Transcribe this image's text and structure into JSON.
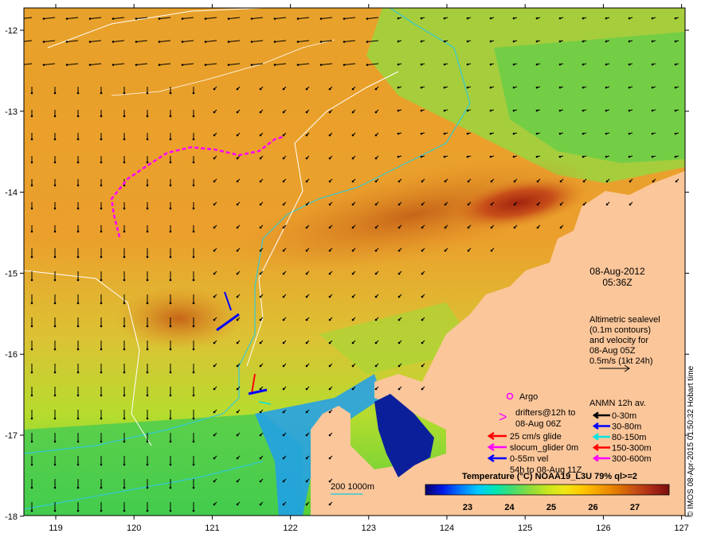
{
  "map": {
    "date": "08-Aug-2012",
    "time": "05:36Z",
    "lon_ticks": [
      "119",
      "120",
      "121",
      "122",
      "123",
      "124",
      "125",
      "126",
      "127"
    ],
    "lat_ticks": [
      "-12",
      "-13",
      "-14",
      "-15",
      "-16",
      "-17",
      "-18"
    ],
    "altimetry_note": [
      "Altimetric sealevel",
      "(0.1m contours)",
      "and velocity for",
      "08-Aug 05Z",
      "0.5m/s (1kt 24h)"
    ],
    "credit": "© IMOS 08-Apr-2015 01:50:32 Hobart time",
    "bathy_legend": "200  1000m"
  },
  "legend": {
    "argo": "Argo",
    "drifters": [
      "drifters@12h to",
      "08-Aug 06Z"
    ],
    "glide": "25 cm/s glide",
    "slocum": "slocum_glider 0m",
    "vel": [
      "0-55m vel",
      "54h to 08-Aug 11Z"
    ],
    "anmn_title": "ANMN 12h av.",
    "anmn": [
      {
        "label": "0-30m",
        "color": "#000000"
      },
      {
        "label": "30-80m",
        "color": "#0000ff"
      },
      {
        "label": "80-150m",
        "color": "#00e5e5"
      },
      {
        "label": "150-300m",
        "color": "#ff0000"
      },
      {
        "label": "300-600m",
        "color": "#ff00ff"
      }
    ]
  },
  "colorbar": {
    "title": "Temperature (°C) NOAA19_L3U 79% ql>=2",
    "ticks": [
      "23",
      "24",
      "25",
      "26",
      "27"
    ],
    "colors": [
      "#08006b",
      "#0019e6",
      "#0077ff",
      "#00c8ff",
      "#00e6b4",
      "#46dc6e",
      "#8cdc3c",
      "#c8e61e",
      "#f0e614",
      "#ffc800",
      "#f5a000",
      "#e07800",
      "#c85014",
      "#aa2814",
      "#7a0f0f"
    ]
  }
}
